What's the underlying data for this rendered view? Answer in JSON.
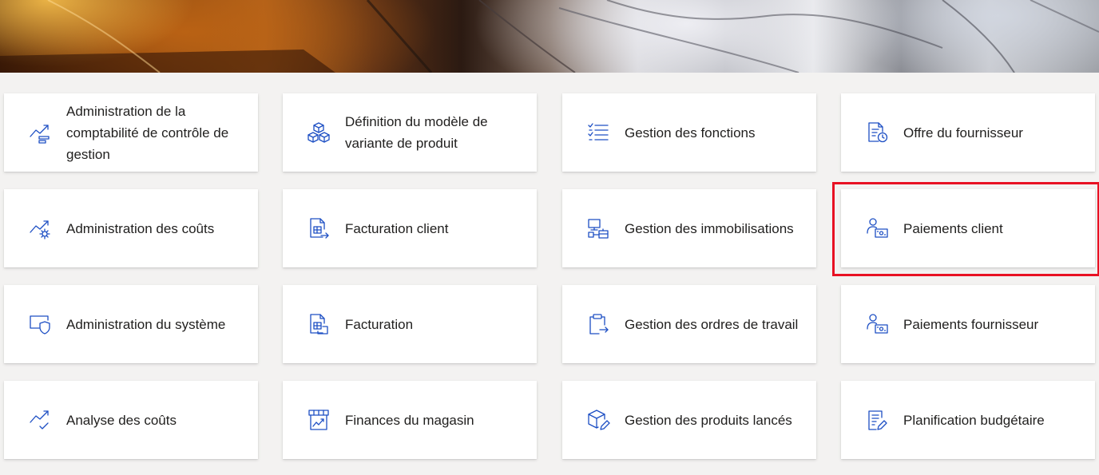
{
  "colors": {
    "accent": "#1d4fc4",
    "highlight": "#e81123",
    "background": "#f3f2f1",
    "tile": "#ffffff"
  },
  "tiles": [
    {
      "label": "Administration de la comptabilité de contrôle de gestion",
      "icon": "chart-trend-icon"
    },
    {
      "label": "Définition du modèle de variante de produit",
      "icon": "cubes-icon"
    },
    {
      "label": "Gestion des fonctions",
      "icon": "checklist-icon"
    },
    {
      "label": "Offre du fournisseur",
      "icon": "document-clock-icon"
    },
    {
      "label": "Administration des coûts",
      "icon": "chart-gear-icon"
    },
    {
      "label": "Facturation client",
      "icon": "invoice-arrow-icon"
    },
    {
      "label": "Gestion des immobilisations",
      "icon": "assets-icon"
    },
    {
      "label": "Paiements client",
      "icon": "person-money-icon"
    },
    {
      "label": "Administration du système",
      "icon": "shield-screen-icon"
    },
    {
      "label": "Facturation",
      "icon": "invoice-icon"
    },
    {
      "label": "Gestion des ordres de travail",
      "icon": "clipboard-arrow-icon"
    },
    {
      "label": "Paiements fournisseur",
      "icon": "person-money-icon"
    },
    {
      "label": "Analyse des coûts",
      "icon": "chart-check-icon"
    },
    {
      "label": "Finances du magasin",
      "icon": "store-chart-icon"
    },
    {
      "label": "Gestion des produits lancés",
      "icon": "box-edit-icon"
    },
    {
      "label": "Planification budgétaire",
      "icon": "document-edit-icon"
    }
  ]
}
